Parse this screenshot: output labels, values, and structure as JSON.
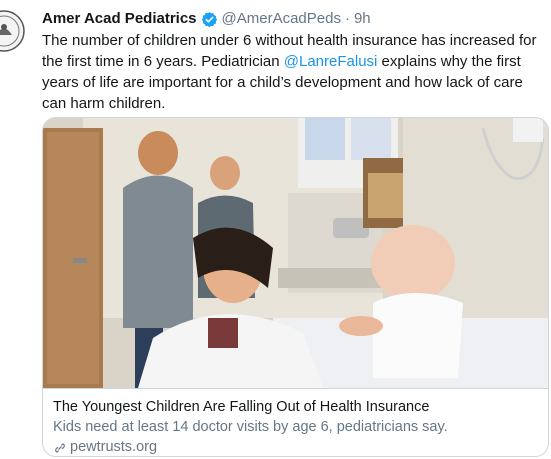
{
  "tweet": {
    "author_name": "Amer Acad Pediatrics",
    "handle": "@AmerAcadPeds",
    "separator": "·",
    "time": "9h",
    "text_before_mention": "The number of children under 6 without health insurance has increased for the first time in 6 years. Pediatrician ",
    "mention": "@LanreFalusi",
    "text_after_mention": " explains why the first years of life are important for a child’s development and how lack of care can harm children."
  },
  "card": {
    "title": "The Youngest Children Are Falling Out of Health Insurance",
    "description": "Kids need at least 14 doctor visits by age 6, pediatricians say.",
    "domain": "pewtrusts.org",
    "image_icon": "photo-clinic-pediatrician-baby"
  },
  "colors": {
    "link_blue": "#1b95e0",
    "verified_blue": "#1da1f2",
    "muted": "#657786",
    "border": "#ccd6dd"
  }
}
